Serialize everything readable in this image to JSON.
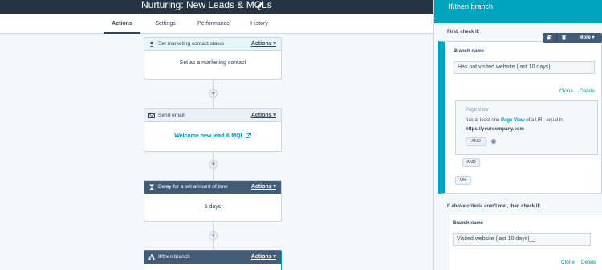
{
  "header": {
    "title": "Nurturing: New Leads & MQLs"
  },
  "tabs": [
    {
      "label": "Actions"
    },
    {
      "label": "Settings"
    },
    {
      "label": "Performance"
    },
    {
      "label": "History"
    }
  ],
  "workflow": {
    "actions_label": "Actions",
    "cards": [
      {
        "title": "Set marketing contact status",
        "body": "Set as a marketing contact"
      },
      {
        "title": "Send email",
        "body": "Welcome new lead & MQL"
      },
      {
        "title": "Delay for a set amount of time",
        "body": "5 days"
      },
      {
        "title": "If/then branch"
      }
    ],
    "plus": "+"
  },
  "panel": {
    "title": "If/then branch",
    "toolbar": {
      "more": "More"
    },
    "first_check_label": "First, check if:",
    "branch1": {
      "name_label": "Branch name",
      "name_value": "Has not visited website (last 10 days)",
      "clone": "Clone",
      "delete": "Delete",
      "filter": {
        "type": "Page View",
        "text_prefix": "has at least one",
        "link": "Page View",
        "text_suffix": "of a URL equal to",
        "url": "https://yourcompany.com",
        "and_inner": "AND"
      },
      "and": "AND",
      "or": "OR"
    },
    "second_check_label": "If above criteria aren't met, then check if:",
    "branch2": {
      "name_label": "Branch name",
      "name_value": "Visited website (last 10 days)__",
      "clone": "Clone",
      "delete": "Delete"
    }
  },
  "colors": {
    "topbar": "#253342",
    "panel_header": "#00a4bd",
    "link": "#0091ae",
    "dark_header": "#425b76"
  }
}
